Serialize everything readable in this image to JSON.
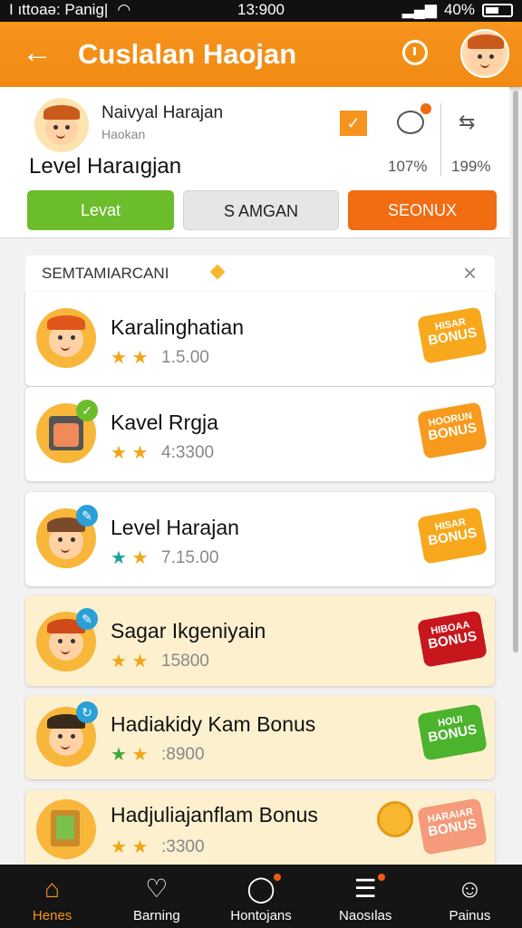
{
  "status": {
    "carrier": "I ıttoaə: Panig|",
    "time": "13:900",
    "battery": "40%"
  },
  "appbar": {
    "title": "Cuslalan Haojan"
  },
  "profile": {
    "name": "Naivyal Harajan",
    "subtitle": "Haokan",
    "level": "Level Haraıgjan",
    "stat1": "107%",
    "stat2": "199%"
  },
  "buttons": {
    "green": "Levat",
    "gray": "S AMGAN",
    "orange": "SEONUX"
  },
  "list": {
    "header": "SEMTAMIARCANI",
    "items": [
      {
        "name": "Karalinghatian",
        "points": "1.5.00",
        "badge_top": "HISAR",
        "badge_bottom": "BONUS",
        "badge_color": "#f7a81d"
      },
      {
        "name": "Kavel Rrgja",
        "points": "4:3300",
        "badge_top": "HOORUN",
        "badge_bottom": "BONUS",
        "badge_color": "#f79a1d"
      },
      {
        "name": "Level Harajan",
        "points": "7.15.00",
        "badge_top": "HISAR",
        "badge_bottom": "BONUS",
        "badge_color": "#f7a81d"
      },
      {
        "name": "Sagar Ikgeniyain",
        "points": "15800",
        "badge_top": "HIBOAA",
        "badge_bottom": "BONUS",
        "badge_color": "#c8161d"
      },
      {
        "name": "Hadiakidy Kam Bonus",
        "points": ":8900",
        "badge_top": "HOUI",
        "badge_bottom": "BONUS",
        "badge_color": "#4bb32c"
      },
      {
        "name": "Hadjuliajanflam Bonus",
        "points": ":3300",
        "badge_top": "HARAIAR",
        "badge_bottom": "BONUS",
        "badge_color": "#f59a7a"
      }
    ]
  },
  "nav": [
    {
      "label": "Henes",
      "icon": "home-icon"
    },
    {
      "label": "Barning",
      "icon": "heart-icon"
    },
    {
      "label": "Hontojans",
      "icon": "chat-icon"
    },
    {
      "label": "Naosılas",
      "icon": "list-icon"
    },
    {
      "label": "Painus",
      "icon": "profile-icon"
    }
  ],
  "colors": {
    "accent": "#f7941d",
    "green": "#6cbd2c",
    "orange": "#f26c12"
  }
}
